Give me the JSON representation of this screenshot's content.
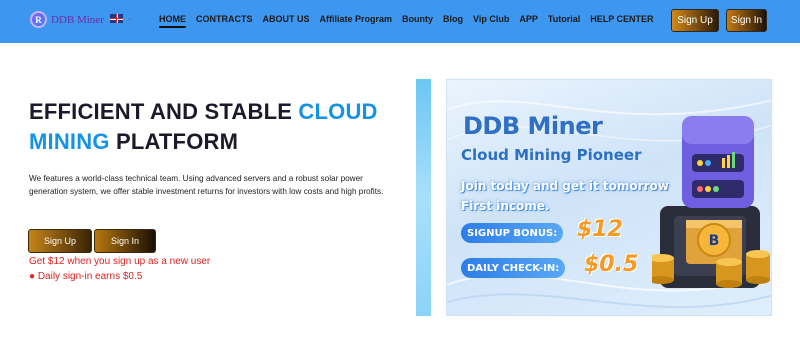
{
  "header": {
    "logo_text": "DDB Miner",
    "logo_mark": "R",
    "language_flag": "uk-flag-icon",
    "nav": [
      {
        "label": "HOME",
        "active": true
      },
      {
        "label": "CONTRACTS",
        "active": false
      },
      {
        "label": "ABOUT US",
        "active": false
      },
      {
        "label": "Affiliate Program",
        "active": false
      },
      {
        "label": "Bounty",
        "active": false
      },
      {
        "label": "Blog",
        "active": false
      },
      {
        "label": "Vip Club",
        "active": false
      },
      {
        "label": "APP",
        "active": false
      },
      {
        "label": "Tutorial",
        "active": false
      },
      {
        "label": "HELP CENTER",
        "active": false
      }
    ],
    "signup_label": "Sign Up",
    "signin_label": "Sign In",
    "background_color": "#3d96f0"
  },
  "hero": {
    "headline_part1": "EFFICIENT AND STABLE ",
    "headline_accent1": "CLOUD",
    "headline_accent2": "MINING",
    "headline_part2": " PLATFORM",
    "accent_color": "#1593e6",
    "description": "We features a world-class technical team. Using advanced servers and a robust solar power generation system, we offer stable investment returns for investors with low costs and high profits.",
    "signup_label": "Sign Up",
    "signin_label": "Sign In",
    "note1": "Get $12 when you sign up as a new user",
    "note2": "● Daily sign-in earns $0.5",
    "note_color": "#e32020"
  },
  "banner": {
    "title": "DDB Miner",
    "subtitle": "Cloud Mining Pioneer",
    "join_text": "Join today and get it tomorrow First income.",
    "bonus_label": "SIGNUP BONUS:",
    "bonus_value": "$12",
    "checkin_label": "DAILY CHECK-IN:",
    "checkin_value": "$0.5",
    "coin_symbol": "B"
  }
}
